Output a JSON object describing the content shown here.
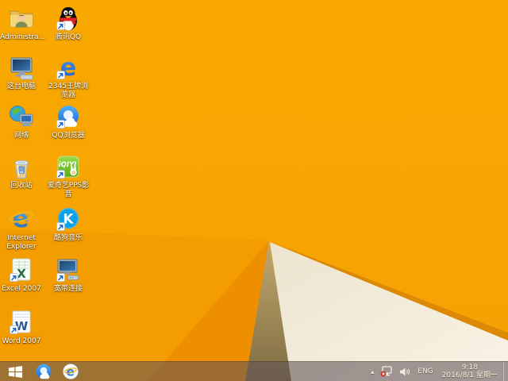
{
  "desktop": {
    "icons": [
      {
        "id": "administrator-folder",
        "label": "Administra..."
      },
      {
        "id": "tencent-qq",
        "label": "腾讯QQ"
      },
      {
        "id": "this-pc",
        "label": "这台电脑"
      },
      {
        "id": "browser-2345",
        "label": "2345王牌浏览器",
        "glyph": "e"
      },
      {
        "id": "network",
        "label": "网络"
      },
      {
        "id": "qq-browser",
        "label": "QQ浏览器"
      },
      {
        "id": "recycle-bin",
        "label": "回收站"
      },
      {
        "id": "iqiyi-pps",
        "label": "爱奇艺PPS影音",
        "glyph": "iQIYI"
      },
      {
        "id": "internet-explorer",
        "label": "Internet Explorer",
        "glyph": "e"
      },
      {
        "id": "kugou-music",
        "label": "酷狗音乐",
        "glyph": "K"
      },
      {
        "id": "excel-2007",
        "label": "Excel 2007",
        "glyph": "X"
      },
      {
        "id": "broadband-connection",
        "label": "宽带连接"
      },
      {
        "id": "word-2007",
        "label": "Word 2007",
        "glyph": "W"
      }
    ]
  },
  "taskbar": {
    "pinned": [
      {
        "id": "start-button"
      },
      {
        "id": "qq-browser-task"
      },
      {
        "id": "internet-explorer-task"
      }
    ],
    "tray": {
      "hidden_icons_arrow": "▴",
      "network_icon": "network-disconnected",
      "volume_icon": "speaker",
      "language": "ENG",
      "time": "9:18",
      "date": "2016/8/1 星期一"
    }
  },
  "colors": {
    "wallpaper_base": "#F7A502",
    "wallpaper_facet_mid": "#F49D00",
    "wallpaper_facet_dark": "#EE8F00",
    "wallpaper_khaki": "#A8905A",
    "wallpaper_cream": "#F2EBDA",
    "wallpaper_shadow_edge": "#DC8A06",
    "taskbar": "rgba(97,83,88,0.58)"
  }
}
